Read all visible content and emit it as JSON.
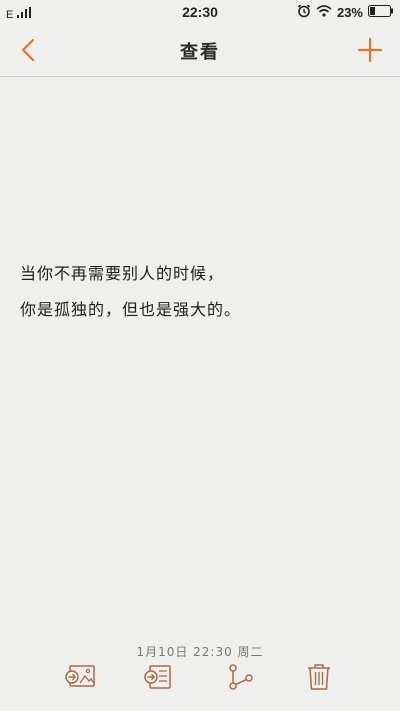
{
  "status_bar": {
    "network": "E",
    "time": "22:30",
    "battery_percent": "23%",
    "icons": [
      "signal-icon",
      "alarm-icon",
      "wifi-icon",
      "battery-icon"
    ]
  },
  "nav": {
    "title": "查看",
    "back_icon": "chevron-left-icon",
    "add_icon": "plus-icon",
    "accent_color": "#e8742a"
  },
  "note": {
    "lines": [
      "当你不再需要别人的时候，",
      "你是孤独的，但也是强大的。"
    ]
  },
  "footer": {
    "timestamp": "1月10日 22:30 周二"
  },
  "toolbar": {
    "icon_color": "#a86a42",
    "items": [
      {
        "icon": "export-image-icon"
      },
      {
        "icon": "export-text-icon"
      },
      {
        "icon": "share-icon"
      },
      {
        "icon": "trash-icon"
      }
    ]
  }
}
